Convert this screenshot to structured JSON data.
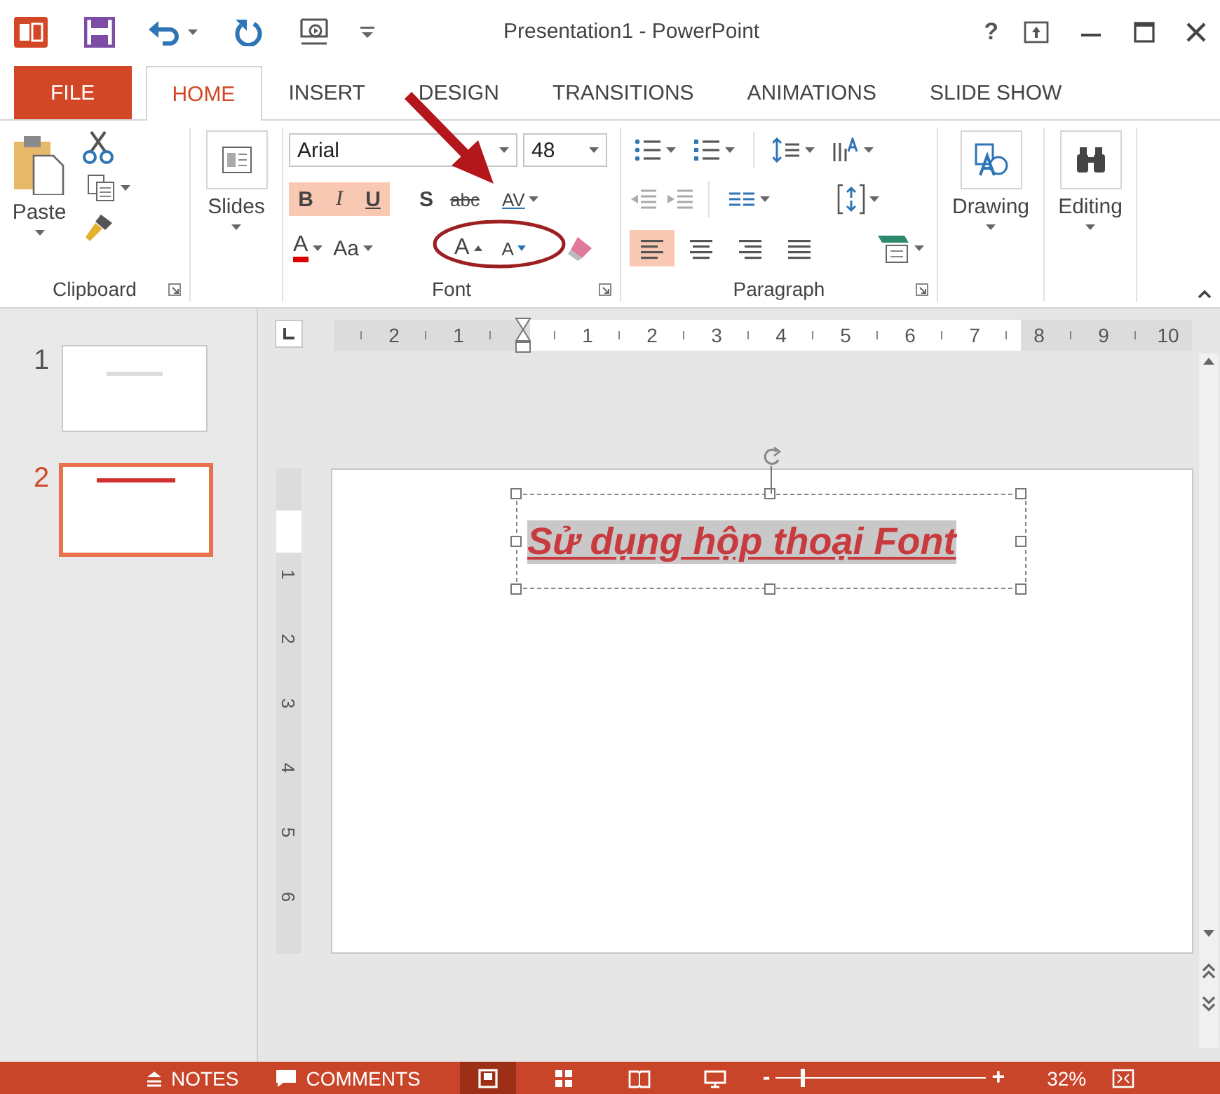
{
  "window": {
    "title": "Presentation1 - PowerPoint",
    "help": "?"
  },
  "tabs": [
    {
      "label": "FILE",
      "kind": "file",
      "selected": false
    },
    {
      "label": "HOME",
      "kind": "tab",
      "selected": true
    },
    {
      "label": "INSERT",
      "kind": "tab",
      "selected": false
    },
    {
      "label": "DESIGN",
      "kind": "tab",
      "selected": false
    },
    {
      "label": "TRANSITIONS",
      "kind": "tab",
      "selected": false
    },
    {
      "label": "ANIMATIONS",
      "kind": "tab",
      "selected": false
    },
    {
      "label": "SLIDE SHOW",
      "kind": "tab",
      "selected": false
    }
  ],
  "ribbon": {
    "clipboard": {
      "label": "Clipboard",
      "paste": "Paste"
    },
    "slides": {
      "label": "Slides"
    },
    "font": {
      "label": "Font",
      "family": "Arial",
      "size": "48",
      "bold_label": "B",
      "italic_label": "I",
      "underline_label": "U",
      "shadow_label": "S",
      "strike_label": "abc",
      "spacing_label": "AV",
      "color_label": "A",
      "case_label": "Aa",
      "grow_label": "A",
      "shrink_label": "A",
      "bold": true,
      "italic": true,
      "underline": true
    },
    "paragraph": {
      "label": "Paragraph",
      "alignments": [
        {
          "kind": "left",
          "selected": true
        },
        {
          "kind": "center",
          "selected": false
        },
        {
          "kind": "right",
          "selected": false
        },
        {
          "kind": "justify",
          "selected": false
        }
      ]
    },
    "drawing": {
      "label": "Drawing"
    },
    "editing": {
      "label": "Editing"
    }
  },
  "ruler": {
    "horizontal": [
      {
        "kind": "number",
        "label": "2"
      },
      {
        "kind": "number",
        "label": "1"
      },
      {
        "kind": "indent"
      },
      {
        "kind": "number",
        "label": "1"
      },
      {
        "kind": "number",
        "label": "2"
      },
      {
        "kind": "number",
        "label": "3"
      },
      {
        "kind": "number",
        "label": "4"
      },
      {
        "kind": "number",
        "label": "5"
      },
      {
        "kind": "number",
        "label": "6"
      },
      {
        "kind": "number",
        "label": "7"
      },
      {
        "kind": "number",
        "label": "8"
      },
      {
        "kind": "number",
        "label": "9"
      },
      {
        "kind": "number",
        "label": "10"
      }
    ],
    "vertical": [
      "1",
      "2",
      "3",
      "4",
      "5",
      "6"
    ]
  },
  "slides": [
    {
      "number": "1",
      "selected": false
    },
    {
      "number": "2",
      "selected": true
    }
  ],
  "slide": {
    "title": "Sử dụng hộp thoại Font",
    "title_selected": true
  },
  "status_bar": {
    "notes": "NOTES",
    "comments": "COMMENTS",
    "views": [
      {
        "kind": "normal",
        "selected": true
      },
      {
        "kind": "sorter",
        "selected": false
      },
      {
        "kind": "reading",
        "selected": false
      },
      {
        "kind": "slideshow",
        "selected": false
      }
    ],
    "zoom": {
      "minus": "-",
      "plus": "+",
      "level": 0.12,
      "reading": "32%"
    }
  }
}
